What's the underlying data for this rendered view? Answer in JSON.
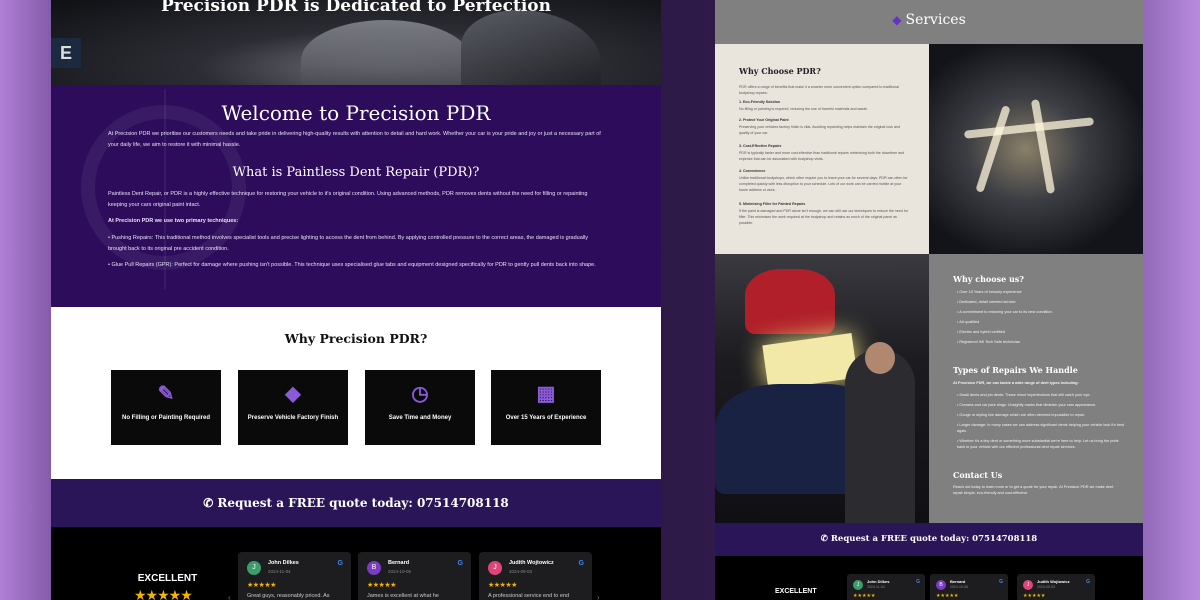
{
  "left": {
    "hero_title": "Precision PDR is Dedicated to Perfection",
    "hero_plate": "E",
    "welcome": {
      "title": "Welcome to Precision PDR",
      "intro": "At Precision PDR we prioritise our customers needs and take pride in delivering high-quality results with attention to detail and hard work. Whether your car is your pride and joy or just a necessary part of your daily life, we aim to restore it with minimal hassle.",
      "subtitle": "What is Paintless Dent Repair (PDR)?",
      "pdr_desc": "Paintless Dent Repair, or PDR is a highly effective technique for restoring your vehicle to it's original condition. Using advanced methods, PDR removes dents without the need for filling or repainting keeping your cars original paint intact.",
      "techniques_label": "At Precision PDR we use two primary techniques:",
      "technique_1": "• Pushing Repairs: This traditional method involves specialist tools and precise lighting to access the dent from behind. By applying controlled pressure to the correct areas, the damaged is gradually brought back to its original pre accident condition.",
      "technique_2": "• Glue Pull Repairs (GPR): Perfect for damage where pushing isn't possible. This technique uses specialised glue tabs and equipment designed specifically for PDR to gently pull dents back into shape."
    },
    "why": {
      "title": "Why Precision PDR?",
      "cards": [
        {
          "icon": "spray-gun-icon",
          "label": "No Filling or Painting Required"
        },
        {
          "icon": "diamond-icon",
          "label": "Preserve Vehicle Factory Finish"
        },
        {
          "icon": "clock-money-icon",
          "label": "Save Time and Money"
        },
        {
          "icon": "calendar-icon",
          "label": "Over 15 Years of Experience"
        }
      ]
    },
    "quote": "Request a FREE quote today: 07514708118",
    "reviews": {
      "rating_label": "EXCELLENT",
      "stars": "★★★★★",
      "items": [
        {
          "initial": "J",
          "name": "John Dilkes",
          "date": "2024-11-04",
          "stars": "★★★★★",
          "text": "Great guys, reasonably priced. As",
          "color": "#3c9c6c"
        },
        {
          "initial": "B",
          "name": "Bernard",
          "date": "2024-10-06",
          "stars": "★★★★★",
          "text": "James is excellent at what he",
          "color": "#7a3cc4"
        },
        {
          "initial": "J",
          "name": "Judith Wojtowicz",
          "date": "2024-09-03",
          "stars": "★★★★★",
          "text": "A professional service end to end",
          "color": "#e0447c"
        }
      ]
    }
  },
  "right": {
    "services_title": "Services",
    "choose": {
      "title": "Why Choose PDR?",
      "lines": [
        {
          "head": false,
          "text": "PDR offers a range of benefits that make it a smarter more convenient option compared to traditional bodyshop repairs:"
        },
        {
          "head": true,
          "text": "1. Eco-Friendly Solution"
        },
        {
          "head": false,
          "text": "No filling or painting is required, reducing the use of harmful materials and waste."
        },
        {
          "head": true,
          "text": "2. Protect Your Original Paint"
        },
        {
          "head": false,
          "text": "Preserving your vehicles factory finish is vital. Avoiding repainting helps maintain the original look and quality of your car."
        },
        {
          "head": true,
          "text": "3. Cost-Effective Repairs"
        },
        {
          "head": false,
          "text": "PDR is typically faster and more cost-effective than traditional repairs minimising both the downtime and expense that can be associated with bodyshop visits."
        },
        {
          "head": true,
          "text": "4. Convenience"
        },
        {
          "head": false,
          "text": "Unlike traditional bodyshops, which often require you to leave your car for several days, PDR can often be completed quickly with less disruption to your schedule. Lots of our work can be carried mobile at your home address or work."
        },
        {
          "head": true,
          "text": "5. Minimising Filler for Painted Repairs"
        },
        {
          "head": false,
          "text": "If the paint is damaged and PDR alone isn't enough, we can still use our techniques to reduce the need for filler. This minimises the work required at the bodyshop and retains as much of the original panel as possible."
        }
      ]
    },
    "why_choose": {
      "title": "Why choose us?",
      "items": [
        "Over 15 Years of industry experience",
        "Dedicated, detail oriented service.",
        "A commitment to restoring your car to its best condition.",
        "AA qualified",
        "Electric and hybrid certified",
        "Registered IMI Tech Safe technician"
      ]
    },
    "types": {
      "title": "Types of Repairs We Handle",
      "intro": "At Precision PDR, we can tackle a wide range of dent types including:",
      "items": [
        "Small dents and pin dents: Those minor imperfections that still catch your eye.",
        "Creases and car park dings: Unsightly marks that diminish your cars appearance.",
        "Gouge or styling line damage which are often deemed impossible to repair.",
        "Larger damage: In many cases we can address significant dents helping your vehicle look it's best again.",
        "Whether it's a tiny dent or something more substantial we're here to help. Let us bring the pride back to your vehicle with our efficient professional dent repair services."
      ]
    },
    "contact": {
      "title": "Contact Us",
      "text": "Reach out today to learn more or to get a quote for your repair. At Precision PDR we make dent repair simple, eco-friendly and cost-effective."
    },
    "quote": "Request a FREE quote today: 07514708118",
    "reviews": {
      "rating_label": "EXCELLENT",
      "items": [
        {
          "initial": "J",
          "name": "John Dilkes",
          "date": "2024-11-04",
          "stars": "★★★★★",
          "color": "#3c9c6c"
        },
        {
          "initial": "B",
          "name": "Bernard",
          "date": "2024-10-06",
          "stars": "★★★★★",
          "color": "#7a3cc4"
        },
        {
          "initial": "J",
          "name": "Judith Wojtowicz",
          "date": "2024-09-03",
          "stars": "★★★★★",
          "color": "#e0447c"
        }
      ]
    }
  }
}
